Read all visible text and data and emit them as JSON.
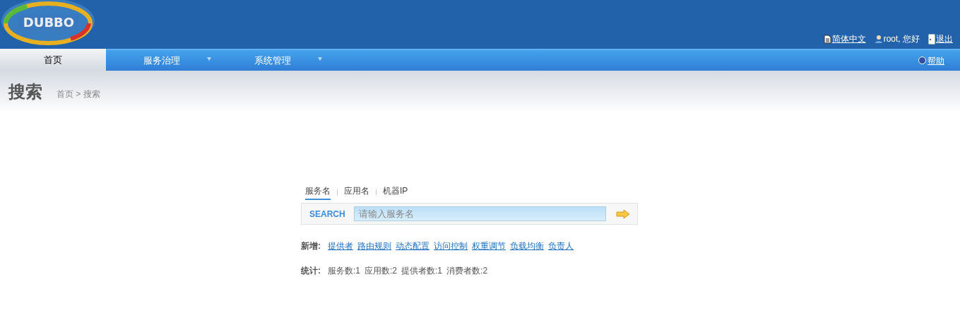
{
  "header": {
    "logo": "DUBBO",
    "links": [
      {
        "kind": "language",
        "label": "简体中文"
      },
      {
        "kind": "user",
        "label": "root, 您好"
      },
      {
        "kind": "logout",
        "label": "退出"
      }
    ]
  },
  "nav": {
    "items": [
      {
        "label": "首页",
        "selected": true,
        "dropdown": false
      },
      {
        "label": "服务治理",
        "selected": false,
        "dropdown": true
      },
      {
        "label": "系统管理",
        "selected": false,
        "dropdown": true
      }
    ],
    "help": "帮助"
  },
  "page": {
    "title": "搜索",
    "breadcrumb": "首页 > 搜索"
  },
  "search": {
    "tabs": [
      {
        "label": "服务名",
        "selected": true
      },
      {
        "label": "应用名",
        "selected": false
      },
      {
        "label": "机器IP",
        "selected": false
      }
    ],
    "label": "SEARCH",
    "placeholder": "请输入服务名"
  },
  "add": {
    "label": "新增:",
    "links": [
      "提供者",
      "路由规则",
      "动态配置",
      "访问控制",
      "权重调节",
      "负载均衡",
      "负责人"
    ]
  },
  "stats": {
    "label": "统计:",
    "items": [
      "服务数:1",
      "应用数:2",
      "提供者数:1",
      "消费者数:2"
    ]
  }
}
